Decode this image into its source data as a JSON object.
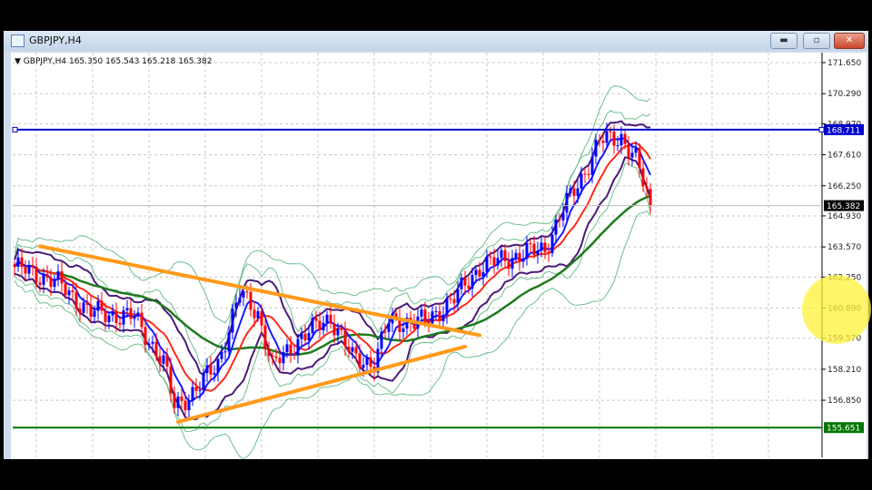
{
  "window": {
    "title": "GBPJPY,H4",
    "buttons": {
      "minimize": "▬",
      "maximize": "▫",
      "close": "✕"
    }
  },
  "chart_header": {
    "symbol": "GBPJPY,H4",
    "open": "165.350",
    "high": "165.543",
    "low": "165.218",
    "close": "165.382"
  },
  "colors": {
    "bull": "#0000ff",
    "bear": "#ff0000",
    "ma_fast": "#1a1aff",
    "ma_mid": "#ff2a1a",
    "ma_slow": "#1e7a1e",
    "band_inner": "#4b1a7a",
    "band_outer": "#6fbf8f",
    "trendline": "#ff9a1a",
    "resistance": "#0000cc",
    "support": "#007700",
    "highlight": "#fff23a"
  },
  "chart_data": {
    "type": "candlestick",
    "symbol": "GBPJPY",
    "timeframe": "H4",
    "ylim": [
      155.3,
      172.0
    ],
    "y_ticks": [
      "171.650",
      "170.290",
      "168.970",
      "167.610",
      "166.250",
      "164.930",
      "163.570",
      "162.250",
      "160.890",
      "159.570",
      "158.210",
      "156.850"
    ],
    "candle_count": 176,
    "close_waypoints": [
      [
        0,
        162.7
      ],
      [
        11,
        162.1
      ],
      [
        21,
        160.7
      ],
      [
        33,
        160.5
      ],
      [
        41,
        158.5
      ],
      [
        44,
        156.6
      ],
      [
        50,
        157.3
      ],
      [
        56,
        158.5
      ],
      [
        62,
        161.5
      ],
      [
        67,
        160.7
      ],
      [
        71,
        158.3
      ],
      [
        78,
        159.5
      ],
      [
        87,
        160.5
      ],
      [
        93,
        158.7
      ],
      [
        99,
        158.5
      ],
      [
        103,
        160.3
      ],
      [
        113,
        160.3
      ],
      [
        121,
        161.3
      ],
      [
        128,
        162.7
      ],
      [
        136,
        163.1
      ],
      [
        146,
        163.5
      ],
      [
        151,
        165.2
      ],
      [
        156,
        166.6
      ],
      [
        161,
        168.2
      ],
      [
        167,
        168.4
      ],
      [
        171,
        167.4
      ],
      [
        175,
        165.382
      ]
    ],
    "horizontal_lines": [
      {
        "name": "resistance",
        "price": 168.711,
        "label": "168.711"
      },
      {
        "name": "support",
        "price": 155.651,
        "label": "155.651"
      }
    ],
    "current_price_label": "165.382",
    "trendlines": [
      {
        "name": "upper",
        "from": [
          7,
          163.6
        ],
        "to": [
          128,
          159.7
        ]
      },
      {
        "name": "lower",
        "from": [
          45,
          155.9
        ],
        "to": [
          124,
          159.2
        ]
      }
    ]
  }
}
